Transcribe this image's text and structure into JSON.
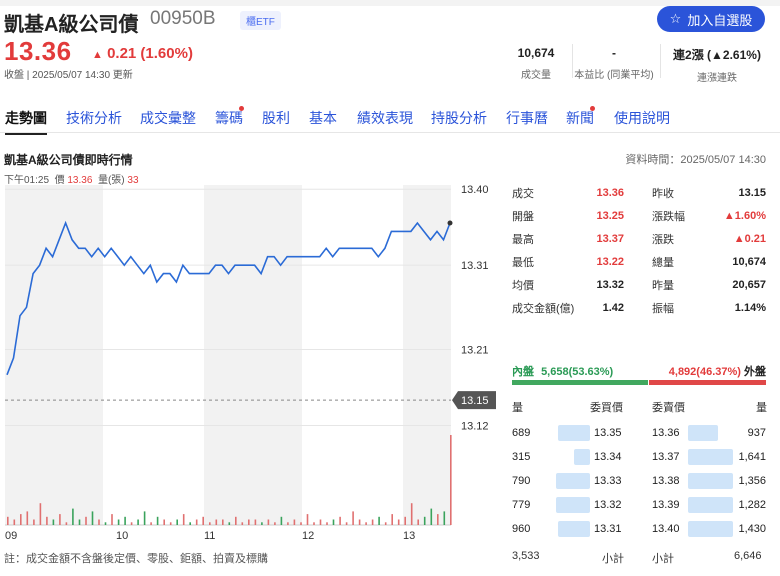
{
  "header": {
    "title": "凱基A級公司債",
    "code": "00950B",
    "etf_badge": "櫃ETF",
    "watch_label": "加入自選股"
  },
  "quote": {
    "price": "13.36",
    "change": "0.21 (1.60%)",
    "meta": "收盤 | 2025/05/07 14:30 更新"
  },
  "stats": [
    {
      "value": "10,674",
      "label": "成交量"
    },
    {
      "value": "-",
      "label": "本益比 (同業平均)"
    },
    {
      "value": "連2漲 (▲2.61%)",
      "label": "連漲連跌"
    }
  ],
  "tabs": [
    "走勢圖",
    "技術分析",
    "成交彙整",
    "籌碼",
    "股利",
    "基本",
    "績效表現",
    "持股分析",
    "行事曆",
    "新聞",
    "使用說明"
  ],
  "section": {
    "title": "凱基A級公司債即時行情",
    "time": "資料時間：2025/05/07 14:30",
    "hover_time": "下午01:25",
    "hover_price_label": "價",
    "hover_price": "13.36",
    "hover_vol_label": "量(張)",
    "hover_vol": "33"
  },
  "chart_data": {
    "type": "line",
    "y_ticks": [
      "13.40",
      "13.31",
      "13.21",
      "13.12"
    ],
    "y_range": [
      13.085,
      13.405
    ],
    "x_ticks": [
      "09",
      "10",
      "11",
      "12",
      "13"
    ],
    "prev_close": "13.15",
    "price_series": [
      13.18,
      13.2,
      13.25,
      13.26,
      13.3,
      13.31,
      13.33,
      13.32,
      13.34,
      13.36,
      13.34,
      13.33,
      13.33,
      13.32,
      13.33,
      13.32,
      13.33,
      13.32,
      13.31,
      13.32,
      13.31,
      13.3,
      13.31,
      13.29,
      13.3,
      13.3,
      13.29,
      13.31,
      13.3,
      13.3,
      13.3,
      13.3,
      13.31,
      13.31,
      13.3,
      13.31,
      13.31,
      13.31,
      13.31,
      13.3,
      13.32,
      13.32,
      13.31,
      13.32,
      13.32,
      13.32,
      13.32,
      13.32,
      13.32,
      13.33,
      13.32,
      13.33,
      13.33,
      13.33,
      13.33,
      13.33,
      13.33,
      13.32,
      13.33,
      13.35,
      13.35,
      13.35,
      13.35,
      13.36,
      13.35,
      13.34,
      13.35,
      13.34,
      13.36
    ],
    "volumes": [
      3,
      2,
      4,
      5,
      2,
      8,
      3,
      2,
      4,
      1,
      6,
      2,
      3,
      5,
      2,
      1,
      4,
      2,
      3,
      1,
      2,
      5,
      1,
      3,
      2,
      1,
      2,
      4,
      1,
      2,
      3,
      1,
      2,
      2,
      1,
      3,
      1,
      2,
      2,
      1,
      2,
      1,
      3,
      1,
      2,
      1,
      4,
      1,
      2,
      1,
      2,
      3,
      1,
      5,
      2,
      1,
      2,
      3,
      1,
      4,
      2,
      3,
      8,
      2,
      3,
      6,
      4,
      5,
      33
    ]
  },
  "quote_table": [
    {
      "k": "成交",
      "v": "13.36",
      "c": "red"
    },
    {
      "k": "昨收",
      "v": "13.15",
      "c": ""
    },
    {
      "k": "開盤",
      "v": "13.25",
      "c": "red"
    },
    {
      "k": "漲跌幅",
      "v": "▲1.60%",
      "c": "red"
    },
    {
      "k": "最高",
      "v": "13.37",
      "c": "red"
    },
    {
      "k": "漲跌",
      "v": "▲0.21",
      "c": "red"
    },
    {
      "k": "最低",
      "v": "13.22",
      "c": "red"
    },
    {
      "k": "總量",
      "v": "10,674",
      "c": ""
    },
    {
      "k": "均價",
      "v": "13.32",
      "c": ""
    },
    {
      "k": "昨量",
      "v": "20,657",
      "c": ""
    },
    {
      "k": "成交金額(億)",
      "v": "1.42",
      "c": ""
    },
    {
      "k": "振幅",
      "v": "1.14%",
      "c": ""
    }
  ],
  "orderbook": {
    "inner_label": "內盤",
    "inner": "5,658(53.63%)",
    "outer": "4,892(46.37%)",
    "outer_label": "外盤",
    "qty_label": "量",
    "bid_label": "委買價",
    "ask_label": "委賣價",
    "qty_label2": "量",
    "bids": [
      {
        "qty": "689",
        "price": "13.35"
      },
      {
        "qty": "315",
        "price": "13.34"
      },
      {
        "qty": "790",
        "price": "13.33"
      },
      {
        "qty": "779",
        "price": "13.32"
      },
      {
        "qty": "960",
        "price": "13.31"
      }
    ],
    "asks": [
      {
        "price": "13.36",
        "qty": "937"
      },
      {
        "price": "13.37",
        "qty": "1,641"
      },
      {
        "price": "13.38",
        "qty": "1,356"
      },
      {
        "price": "13.39",
        "qty": "1,282"
      },
      {
        "price": "13.40",
        "qty": "1,430"
      }
    ],
    "bid_total": "3,533",
    "subtotal_label": "小計",
    "subtotal_label2": "小計",
    "ask_total": "6,646"
  },
  "footnote": "註：成交金額不含盤後定價、零股、鉅額、拍賣及標購"
}
